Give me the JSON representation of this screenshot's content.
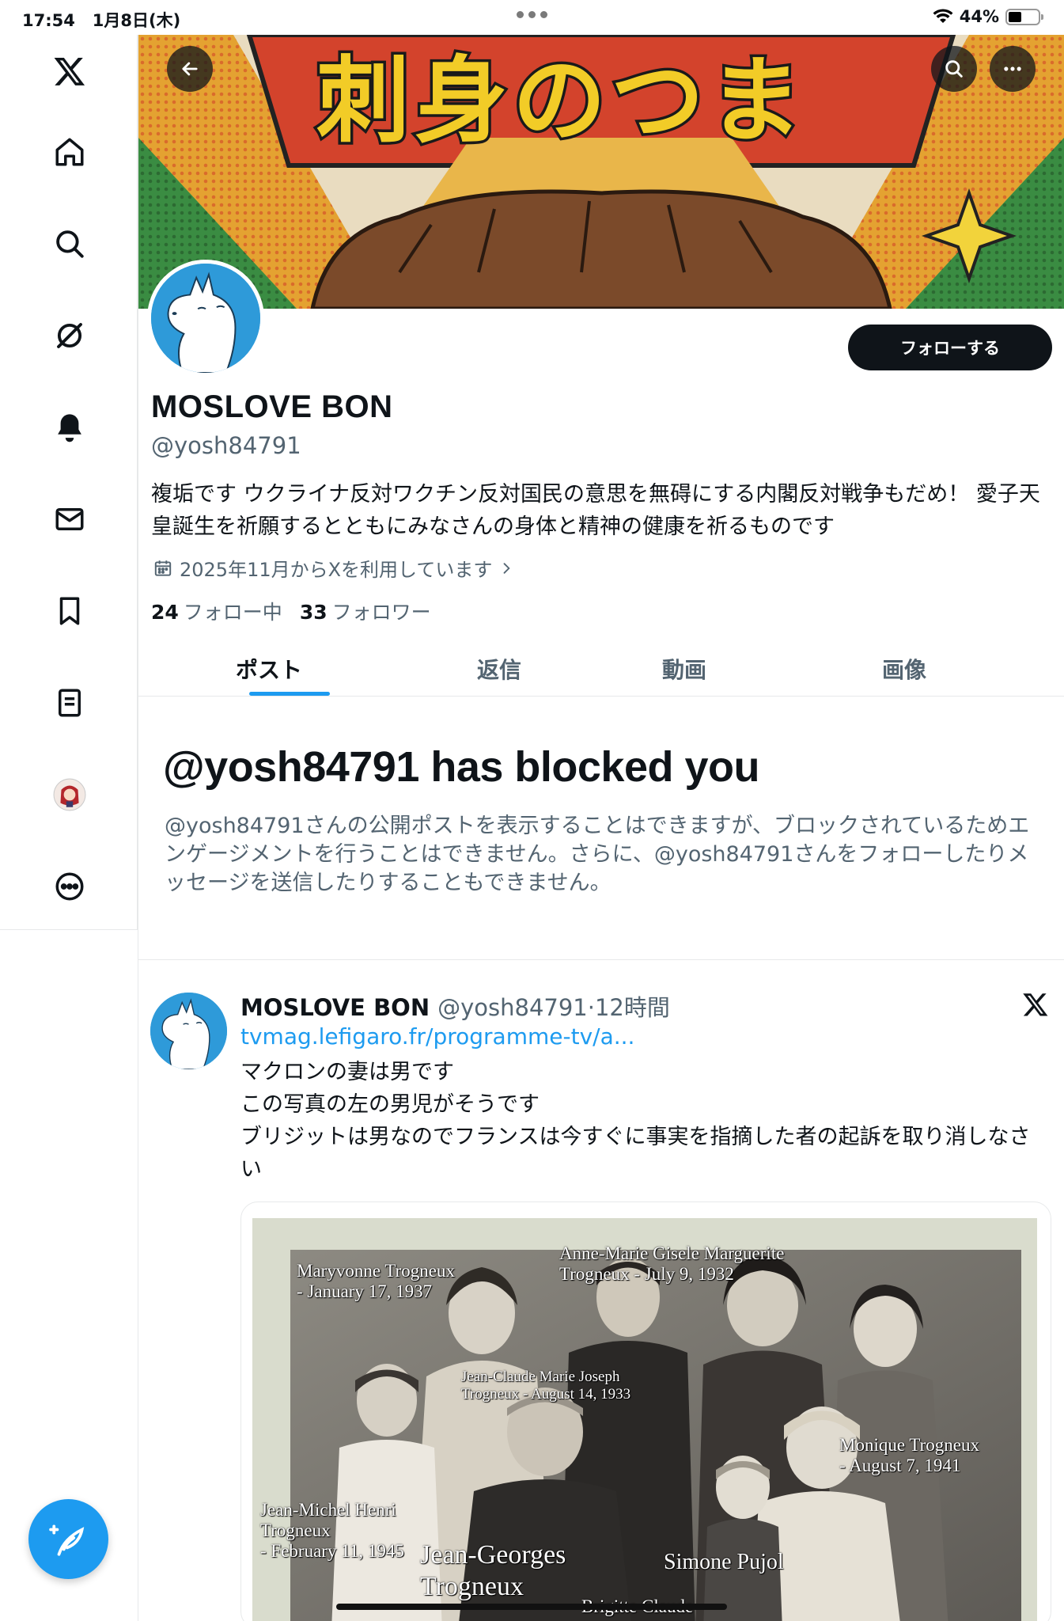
{
  "status": {
    "time": "17:54",
    "date": "1月8日(木)",
    "battery": "44%",
    "battery_level": 0.44
  },
  "sidebar": {
    "items": [
      "x-logo",
      "home",
      "search",
      "grok",
      "notifications",
      "messages",
      "bookmarks",
      "lists",
      "profile",
      "more"
    ]
  },
  "banner": {
    "text": "刺身のつま"
  },
  "profile": {
    "name": "MOSLOVE BON",
    "handle": "@yosh84791",
    "follow_button": "フォローする",
    "bio": "複垢です ウクライナ反対ワクチン反対国民の意思を無碍にする内閣反対戦争もだめ！ 愛子天皇誕生を祈願するとともにみなさんの身体と精神の健康を祈るものです",
    "joined": "2025年11月からXを利用しています",
    "following_count": "24",
    "following_label": "フォロー中",
    "followers_count": "33",
    "followers_label": "フォロワー"
  },
  "tabs": [
    "ポスト",
    "返信",
    "動画",
    "画像"
  ],
  "blocked": {
    "title": "@yosh84791 has blocked you",
    "text": "@yosh84791さんの公開ポストを表示することはできますが、ブロックされているためエンゲージメントを行うことはできません。さらに、@yosh84791さんをフォローしたりメッセージを送信したりすることもできません。"
  },
  "post": {
    "name": "MOSLOVE BON",
    "meta": "@yosh84791·12時間",
    "link": "tvmag.lefigaro.fr/programme-tv/a...",
    "lines": [
      "マクロンの妻は男です",
      "この写真の左の男児がそうです",
      "ブリジットは男なのでフランスは今すぐに事実を指摘した者の起訴を取り消しなさい"
    ],
    "photo_captions": {
      "c1": "Maryvonne Trogneux",
      "c1b": "- January 17, 1937",
      "c2": "Anne-Marie Gisele Marguerite",
      "c2b": "Trogneux - July 9, 1932",
      "c3": "Jean-Claude Marie Joseph",
      "c3b": "Trogneux - August 14, 1933",
      "c4": "Monique Trogneux",
      "c4b": "- August 7, 1941",
      "c5": "Jean-Michel Henri",
      "c5b": "Trogneux",
      "c5c": "- February 11, 1945",
      "c6": "Jean-Georges",
      "c6b": "Trogneux",
      "c7": "Simone Pujol",
      "c8": "Brigitte Claude"
    }
  }
}
